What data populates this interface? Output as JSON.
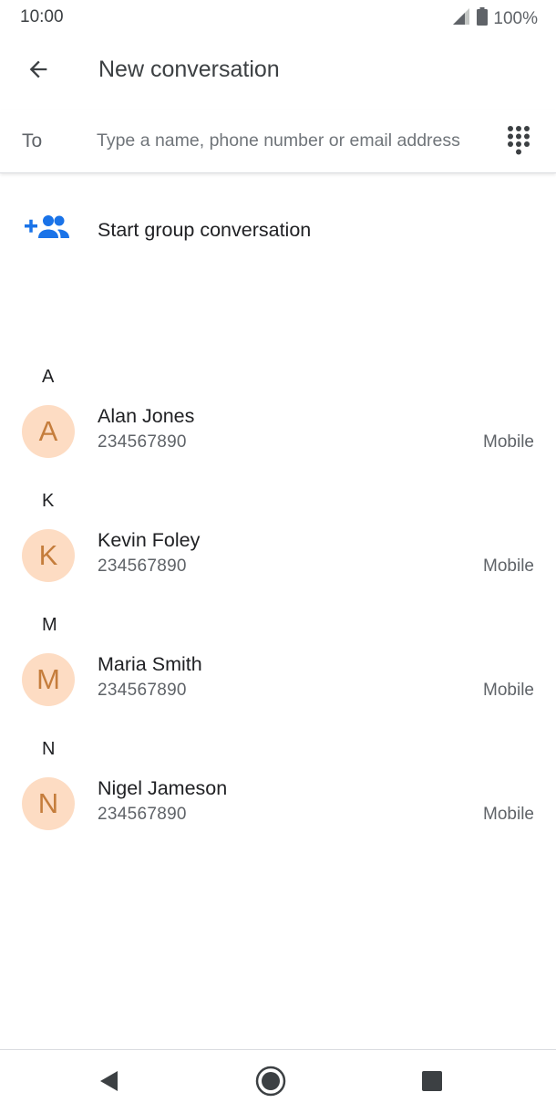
{
  "status_bar": {
    "time": "10:00",
    "battery_percent": "100%",
    "icons": [
      "signal-icon",
      "battery-icon"
    ]
  },
  "header": {
    "back_icon": "arrow-back-icon",
    "title": "New conversation"
  },
  "recipient": {
    "label": "To",
    "placeholder": "Type a name, phone number or email address",
    "value": "",
    "dialpad_icon": "dialpad-icon"
  },
  "group": {
    "icon": "group-add-icon",
    "label": "Start group conversation"
  },
  "contacts": [
    {
      "letter": "A",
      "initial": "A",
      "name": "Alan Jones",
      "number": "234567890",
      "type": "Mobile"
    },
    {
      "letter": "K",
      "initial": "K",
      "name": "Kevin Foley",
      "number": "234567890",
      "type": "Mobile"
    },
    {
      "letter": "M",
      "initial": "M",
      "name": "Maria Smith",
      "number": "234567890",
      "type": "Mobile"
    },
    {
      "letter": "N",
      "initial": "N",
      "name": "Nigel Jameson",
      "number": "234567890",
      "type": "Mobile"
    }
  ],
  "nav": {
    "back_icon": "nav-back-icon",
    "home_icon": "nav-home-icon",
    "recents_icon": "nav-recents-icon"
  },
  "colors": {
    "accent": "#1a73e8",
    "avatar_bg": "#fddcc3",
    "avatar_text": "#c57d3c"
  }
}
